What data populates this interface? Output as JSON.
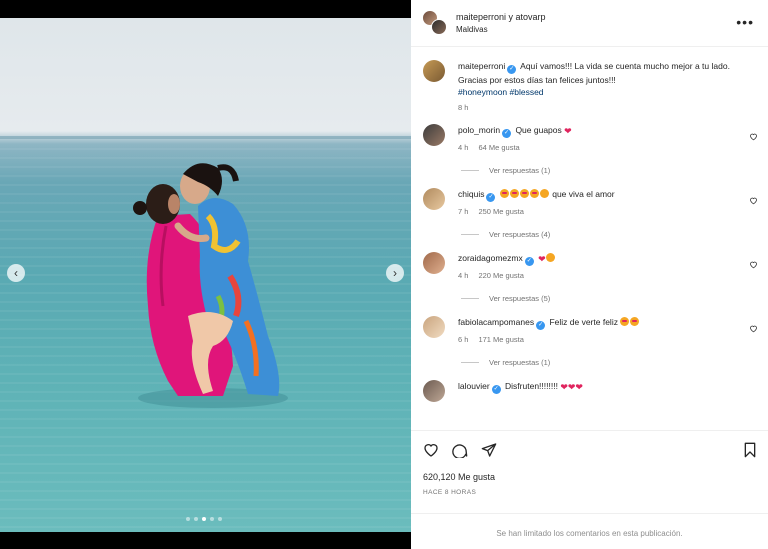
{
  "post": {
    "author_pair": "maiteperroni y atovarp",
    "location": "Maldivas",
    "more_icon": "more-horizontal-icon"
  },
  "caption": {
    "user": "maiteperroni",
    "text": "Aquí vamos!!! La vida se cuenta mucho mejor a tu lado. Gracias por estos días tan felices juntos!!!",
    "tags": "#honeymoon #blessed",
    "time": "8 h"
  },
  "comments": [
    {
      "user": "polo_morin",
      "text": "Que guapos",
      "time": "4 h",
      "likes": "64 Me gusta",
      "replies": "Ver respuestas (1)"
    },
    {
      "user": "chiquis",
      "text": "que viva el amor",
      "time": "7 h",
      "likes": "250 Me gusta",
      "replies": "Ver respuestas (4)"
    },
    {
      "user": "zoraidagomezmx",
      "text": "",
      "time": "4 h",
      "likes": "220 Me gusta",
      "replies": "Ver respuestas (5)"
    },
    {
      "user": "fabiolacampomanes",
      "text": "Feliz de verte feliz",
      "time": "6 h",
      "likes": "171 Me gusta",
      "replies": "Ver respuestas (1)"
    },
    {
      "user": "lalouvier",
      "text": "Disfruten!!!!!!!!",
      "time": "",
      "likes": "",
      "replies": ""
    }
  ],
  "footer": {
    "likes": "620,120 Me gusta",
    "ago": "HACE 8 HORAS",
    "comments_limited": "Se han limitado los comentarios en esta publicación."
  },
  "carousel": {
    "total": 5,
    "active": 3
  },
  "colors": {
    "verified": "#3897f0",
    "heart": "#e0245e",
    "hashtag": "#00376b"
  }
}
